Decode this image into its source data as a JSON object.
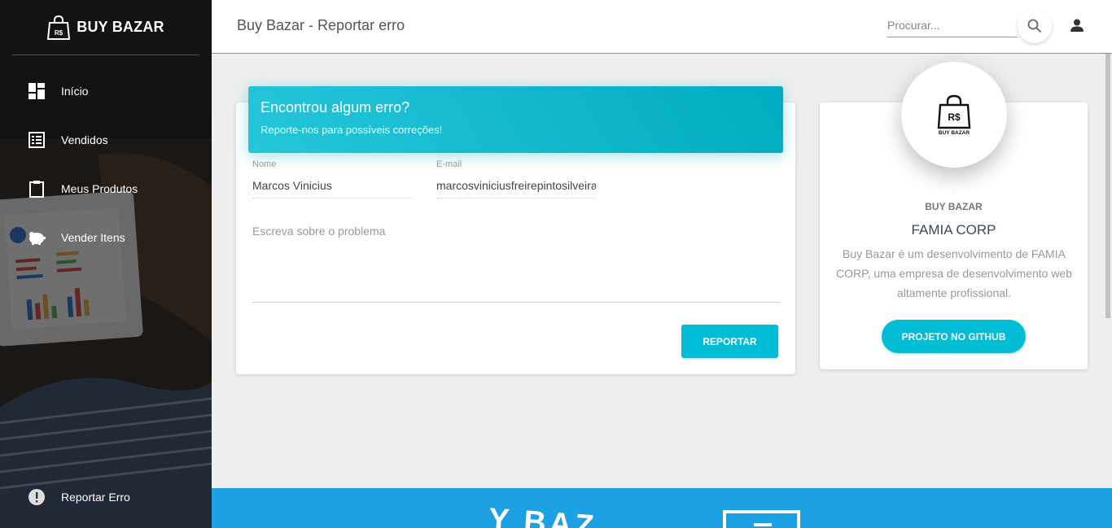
{
  "brand": {
    "name": "BUY BAZAR",
    "logo_text": "R$"
  },
  "sidebar": {
    "items": [
      {
        "label": "Início",
        "icon": "dashboard-icon"
      },
      {
        "label": "Vendidos",
        "icon": "list-icon"
      },
      {
        "label": "Meus Produtos",
        "icon": "clipboard-icon"
      },
      {
        "label": "Vender Itens",
        "icon": "piggy-bank-icon"
      }
    ],
    "bottom_item": {
      "label": "Reportar Erro",
      "icon": "error-icon"
    }
  },
  "header": {
    "title": "Buy Bazar - Reportar erro",
    "search_placeholder": "Procurar...",
    "search_icon": "search-icon",
    "user_icon": "person-icon"
  },
  "form": {
    "header_title": "Encontrou algum erro?",
    "header_subtitle": "Reporte-nos para possíveis correções!",
    "name_label": "Nome",
    "name_value": "Marcos Vinicius",
    "email_label": "E-mail",
    "email_value": "marcosviniciusfreirepintosilveira",
    "problem_placeholder": "Escreva sobre o problema",
    "submit_label": "REPORTAR"
  },
  "profile": {
    "logo_text": "R$",
    "logo_caption": "BUY BAZAR",
    "category": "BUY BAZAR",
    "name": "FAMIA CORP",
    "description": "Buy Bazar é um desenvolvimento de FAMIA CORP, uma empresa de desenvolvimento web altamente profissional.",
    "button_label": "PROJETO NO GITHUB"
  },
  "footer": {
    "banner_text": "Y BAZ"
  },
  "colors": {
    "accent": "#00bcd4",
    "footer": "#1da1e2",
    "sidebar": "#262626"
  }
}
